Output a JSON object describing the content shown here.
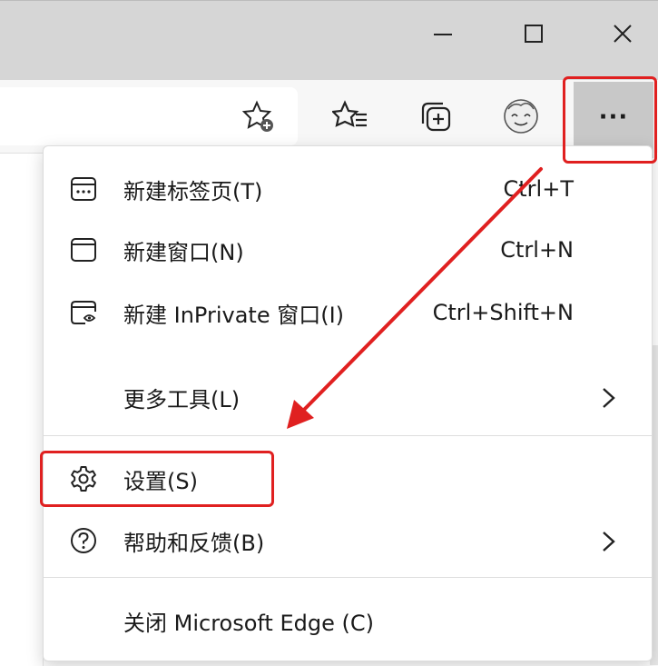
{
  "titlebar": {
    "minimize_icon": "minimize-icon",
    "maximize_icon": "maximize-icon",
    "close_icon": "close-icon"
  },
  "toolbar": {
    "add_favorite_icon": "star-plus-icon",
    "favorites_icon": "favorites-list-icon",
    "collections_icon": "collections-icon",
    "profile_icon": "profile-avatar-icon",
    "more_label": "···"
  },
  "menu": {
    "items": [
      {
        "icon": "new-tab-icon",
        "label": "新建标签页(T)",
        "shortcut": "Ctrl+T"
      },
      {
        "icon": "new-window-icon",
        "label": "新建窗口(N)",
        "shortcut": "Ctrl+N"
      },
      {
        "icon": "inprivate-window-icon",
        "label": "新建 InPrivate 窗口(I)",
        "shortcut": "Ctrl+Shift+N"
      },
      {
        "icon": "",
        "label": "更多工具(L)",
        "shortcut": ""
      },
      {
        "icon": "gear-icon",
        "label": "设置(S)",
        "shortcut": ""
      },
      {
        "icon": "help-icon",
        "label": "帮助和反馈(B)",
        "shortcut": ""
      },
      {
        "icon": "",
        "label": "关闭 Microsoft Edge (C)",
        "shortcut": ""
      }
    ]
  },
  "annotation": {
    "highlight_color": "#e02020"
  }
}
